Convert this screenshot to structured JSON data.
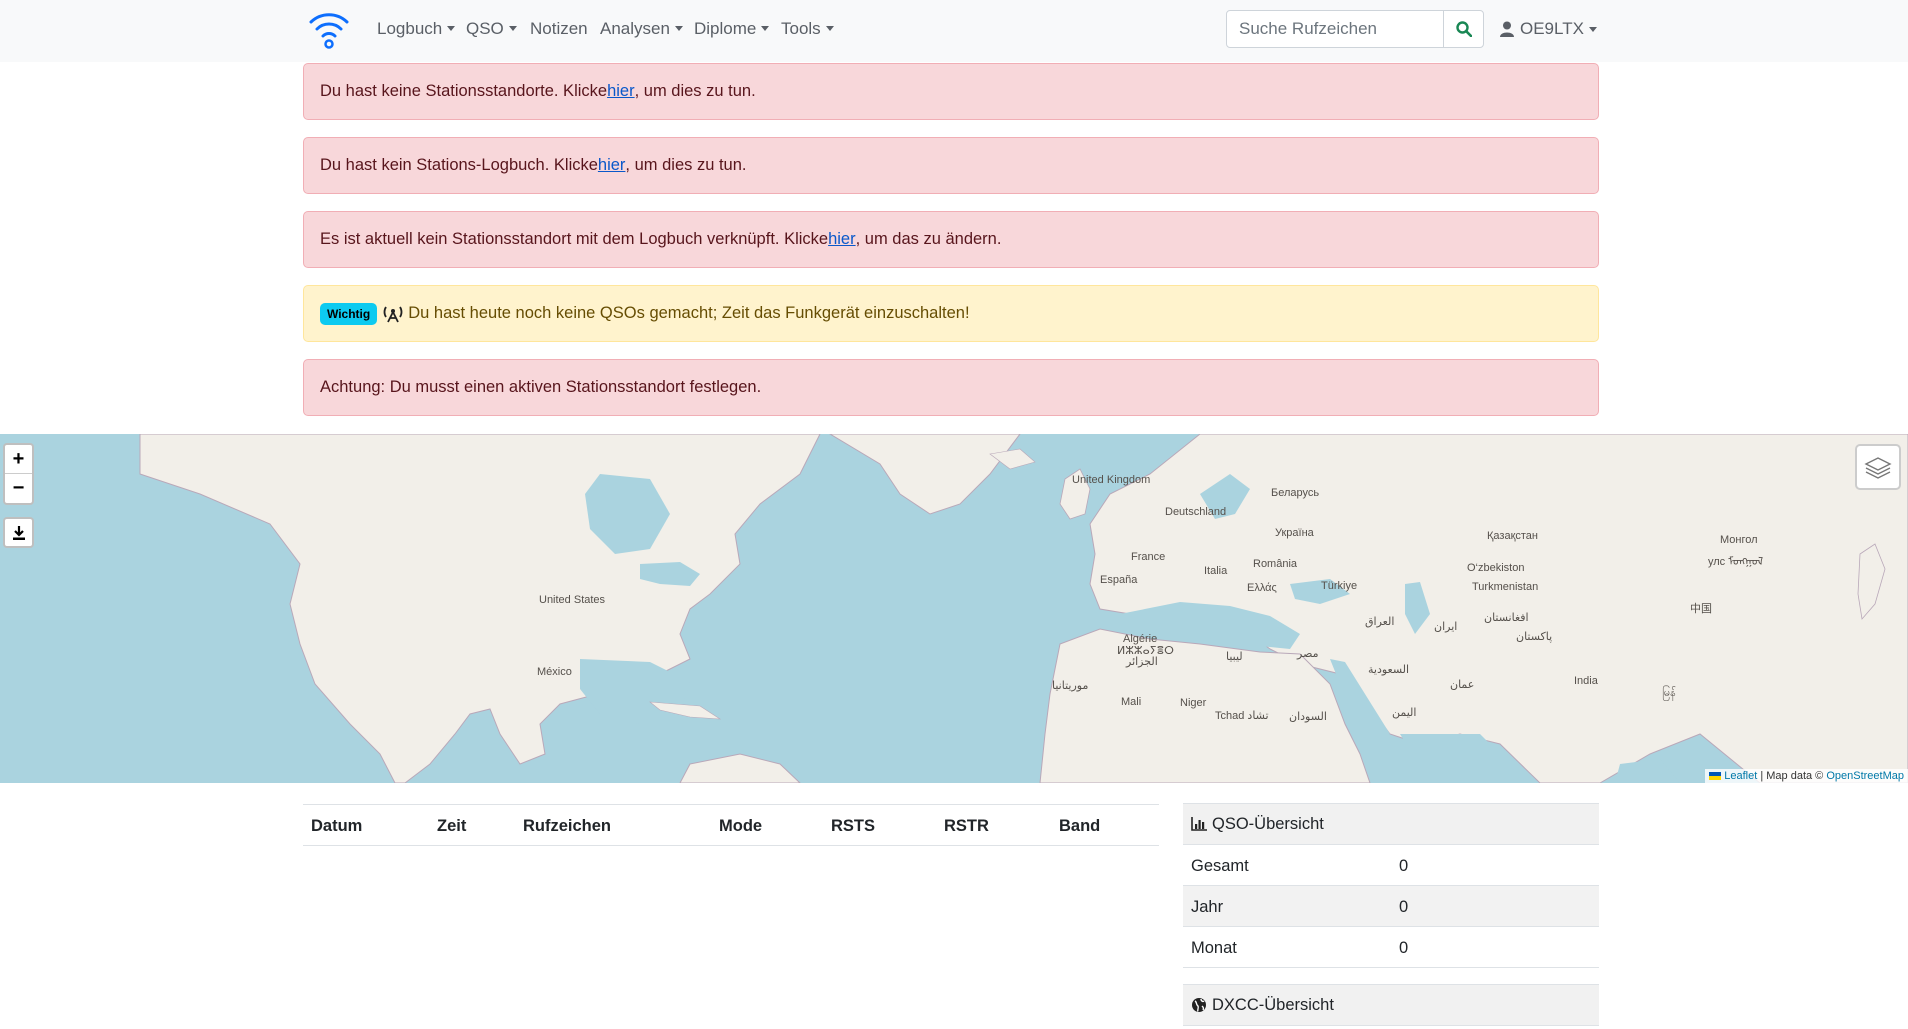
{
  "navbar": {
    "menu": [
      {
        "label": "Logbuch",
        "dropdown": true
      },
      {
        "label": "QSO",
        "dropdown": true
      },
      {
        "label": "Notizen",
        "dropdown": false
      },
      {
        "label": "Analysen",
        "dropdown": true
      },
      {
        "label": "Diplome",
        "dropdown": true
      },
      {
        "label": "Tools",
        "dropdown": true
      }
    ],
    "search_placeholder": "Suche Rufzeichen",
    "user": "OE9LTX",
    "icons": {
      "logo": "wifi-signal-logo",
      "search": "search-icon",
      "user": "user-icon"
    },
    "accent_color": "#0d6efd",
    "search_icon_color": "#198754"
  },
  "alerts": [
    {
      "type": "danger",
      "before": "Du hast keine Stationsstandorte. Klicke ",
      "link": "hier",
      "after": ", um dies zu tun."
    },
    {
      "type": "danger",
      "before": "Du hast kein Stations-Logbuch. Klicke ",
      "link": "hier",
      "after": ", um dies zu tun."
    },
    {
      "type": "danger",
      "before": "Es ist aktuell kein Stationsstandort mit dem Logbuch verknüpft. Klicke ",
      "link": "hier",
      "after": ", um das zu ändern."
    },
    {
      "type": "warning",
      "badge": "Wichtig",
      "text": "Du hast heute noch keine QSOs gemacht; Zeit das Funkgerät einzuschalten!"
    },
    {
      "type": "danger",
      "text": "Achtung: Du musst einen aktiven Stationsstandort festlegen."
    }
  ],
  "map": {
    "zoom_in": "+",
    "zoom_out": "−",
    "labels": [
      "United Kingdom",
      "Беларусь",
      "Deutschland",
      "Україна",
      "Қазақстан",
      "Монгол",
      "улс ᠮᠣᠩᠭᠣᠯ",
      "France",
      "România",
      "O‘zbekiston",
      "España",
      "Italia",
      "Ελλάς",
      "Türkiye",
      "Turkmenistan",
      "United States",
      "中国",
      "العراق",
      "ایران",
      "افغانستان",
      "Algérie",
      "ⵍⵣⵣⴰⵢⴻⵔ",
      "الجزائر",
      "ليبيا",
      "مصر",
      "پاکستان",
      "México",
      "السعودية",
      "India",
      "عمان",
      "موريتانيا",
      "Mali",
      "Niger",
      "Tchad تشاد",
      "السودان",
      "اليمن",
      "မြန်"
    ],
    "attribution_leaflet": "Leaflet",
    "attribution_text": " | Map data © ",
    "attribution_osm": "OpenStreetMap"
  },
  "qso_table": {
    "columns": [
      "Datum",
      "Zeit",
      "Rufzeichen",
      "Mode",
      "RSTS",
      "RSTR",
      "Band"
    ],
    "rows": []
  },
  "qso_summary": {
    "title": "QSO-Übersicht",
    "rows": [
      {
        "label": "Gesamt",
        "value": "0"
      },
      {
        "label": "Jahr",
        "value": "0"
      },
      {
        "label": "Monat",
        "value": "0"
      }
    ]
  },
  "dxcc_summary": {
    "title": "DXCC-Übersicht"
  }
}
